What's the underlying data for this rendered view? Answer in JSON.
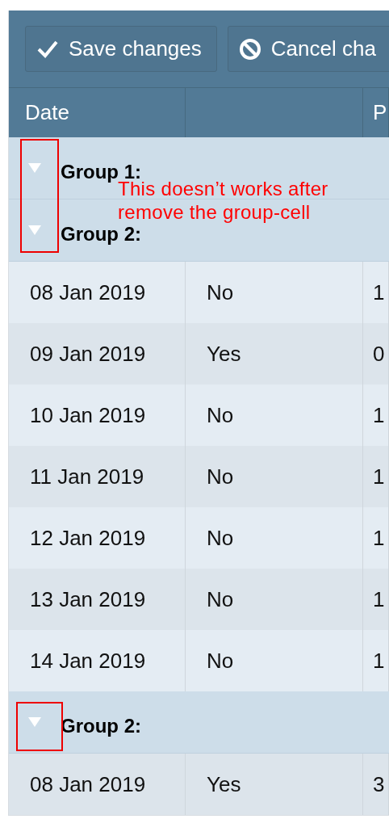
{
  "toolbar": {
    "buttons": [
      {
        "kind": "save",
        "label": "Save changes"
      },
      {
        "kind": "cancel",
        "label": "Cancel cha"
      }
    ]
  },
  "table": {
    "columns": [
      {
        "label": "Date"
      },
      {},
      {
        "label": "P"
      }
    ],
    "groups": [
      {
        "label": "Group 1:",
        "expanded": true,
        "children": [
          {
            "label": "Group 2:",
            "expanded": true,
            "rows": [
              {
                "date": "08 Jan 2019",
                "column_2": "No",
                "column_3": "1"
              },
              {
                "date": "09 Jan 2019",
                "column_2": "Yes",
                "column_3": "0"
              },
              {
                "date": "10 Jan 2019",
                "column_2": "No",
                "column_3": "1"
              },
              {
                "date": "11 Jan 2019",
                "column_2": "No",
                "column_3": "1"
              },
              {
                "date": "12 Jan 2019",
                "column_2": "No",
                "column_3": "1"
              },
              {
                "date": "13 Jan 2019",
                "column_2": "No",
                "column_3": "1"
              },
              {
                "date": "14 Jan 2019",
                "column_2": "No",
                "column_3": "1"
              }
            ]
          },
          {
            "label": "Group 2:",
            "expanded": true,
            "rows": [
              {
                "date": "08 Jan 2019",
                "column_2": "Yes",
                "column_3": "3"
              }
            ]
          }
        ]
      }
    ]
  },
  "annotation": {
    "note": "This doesn’t works after remove the group-cell"
  }
}
